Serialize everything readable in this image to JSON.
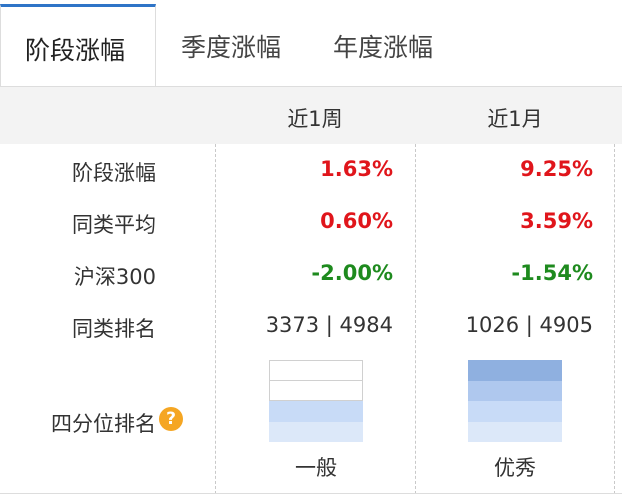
{
  "tabs": [
    {
      "label": "阶段涨幅",
      "active": true
    },
    {
      "label": "季度涨幅",
      "active": false
    },
    {
      "label": "年度涨幅",
      "active": false
    }
  ],
  "columns": [
    "近1周",
    "近1月"
  ],
  "rows": [
    {
      "label": "阶段涨幅",
      "values": [
        "1.63%",
        "9.25%"
      ],
      "colors": [
        "red",
        "red"
      ]
    },
    {
      "label": "同类平均",
      "values": [
        "0.60%",
        "3.59%"
      ],
      "colors": [
        "red",
        "red"
      ]
    },
    {
      "label": "沪深300",
      "values": [
        "-2.00%",
        "-1.54%"
      ],
      "colors": [
        "green",
        "green"
      ]
    },
    {
      "label": "同类排名",
      "values": [
        "3373 | 4984",
        "1026 | 4905"
      ],
      "colors": [
        "plain",
        "plain"
      ]
    }
  ],
  "quartile": {
    "label": "四分位排名",
    "help_icon": "question-icon",
    "ratings": [
      "一般",
      "优秀"
    ],
    "filled_quarters": [
      2,
      4
    ]
  },
  "colors": {
    "accent": "#2e74c7",
    "positive": "#e0151b",
    "negative": "#1e8a1e",
    "quartile_dark": "#8fb0e0",
    "quartile_light": "#dce8f9",
    "help_icon": "#f5a623"
  }
}
